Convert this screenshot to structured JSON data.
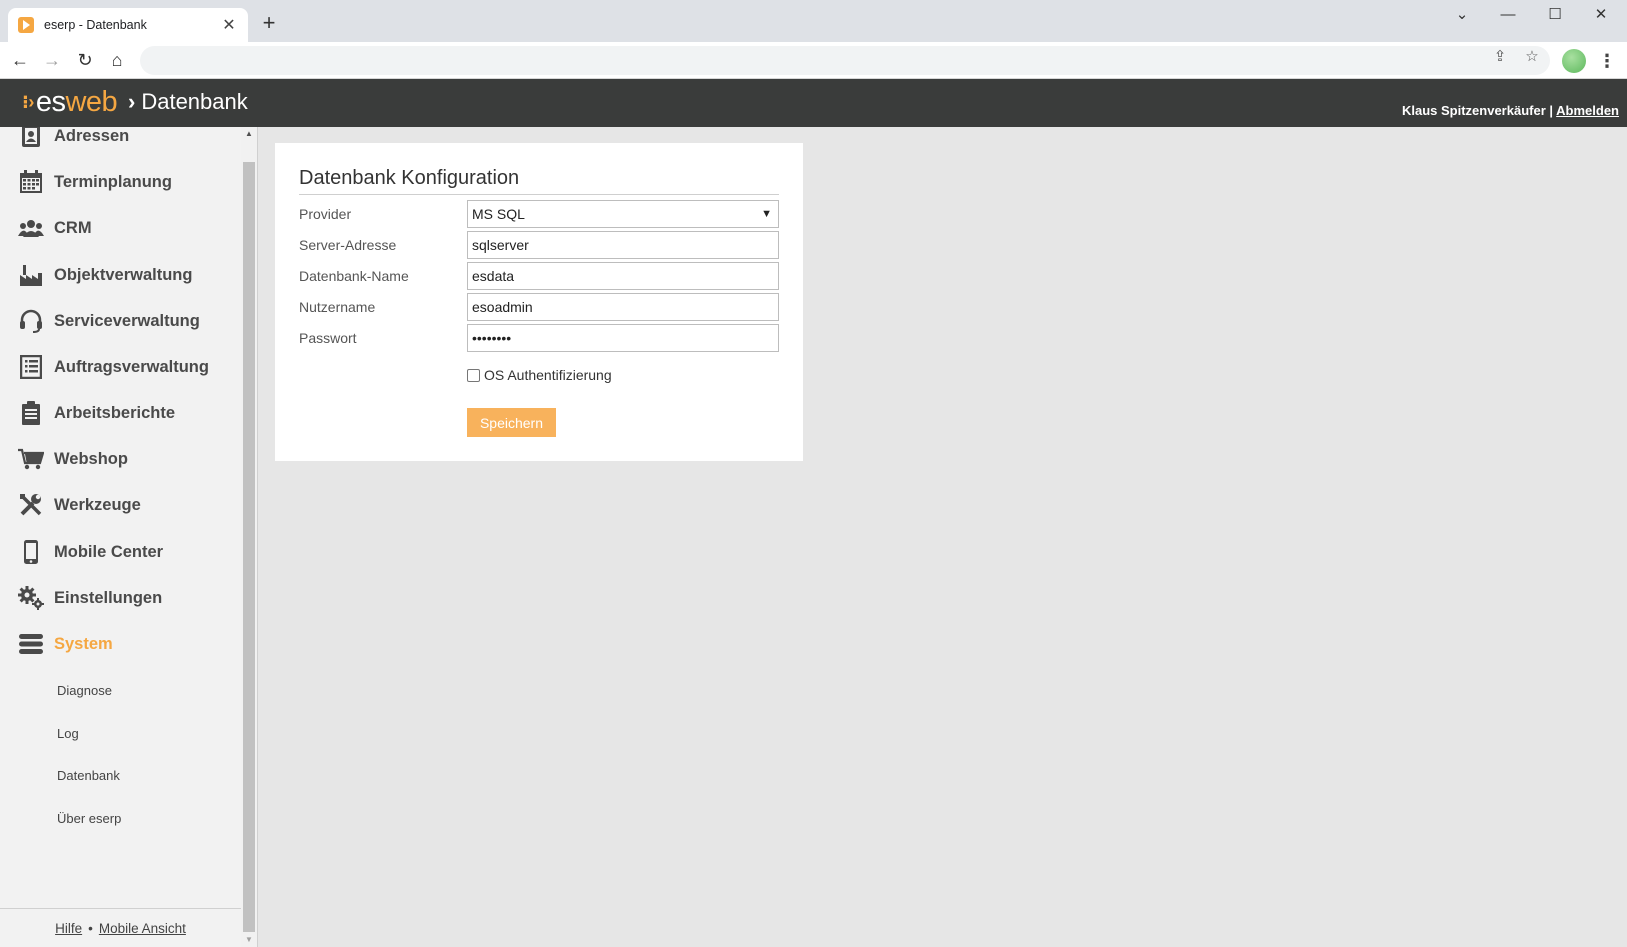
{
  "browser": {
    "tab_title": "eserp - Datenbank",
    "tab_close": "✕",
    "new_tab": "+",
    "nav": {
      "back": "←",
      "forward": "→",
      "reload": "↻",
      "home": "⌂"
    },
    "window_controls": {
      "minimize": "—",
      "maximize": "☐",
      "close": "✕",
      "tab_search": "⌄"
    },
    "url": "",
    "menu": "⋮"
  },
  "header": {
    "logo_es": "es",
    "logo_web": "web",
    "breadcrumb_sep": "›",
    "breadcrumb": "Datenbank",
    "user": "Klaus Spitzenverkäufer |",
    "logout": "Abmelden"
  },
  "sidebar": {
    "items": [
      {
        "label": "Adressen",
        "icon": "address-book-icon"
      },
      {
        "label": "Terminplanung",
        "icon": "calendar-icon"
      },
      {
        "label": "CRM",
        "icon": "users-icon"
      },
      {
        "label": "Objektverwaltung",
        "icon": "factory-icon"
      },
      {
        "label": "Serviceverwaltung",
        "icon": "headset-icon"
      },
      {
        "label": "Auftragsverwaltung",
        "icon": "list-icon"
      },
      {
        "label": "Arbeitsberichte",
        "icon": "clipboard-icon"
      },
      {
        "label": "Webshop",
        "icon": "cart-icon"
      },
      {
        "label": "Werkzeuge",
        "icon": "tools-icon"
      },
      {
        "label": "Mobile Center",
        "icon": "mobile-icon"
      },
      {
        "label": "Einstellungen",
        "icon": "gears-icon"
      },
      {
        "label": "System",
        "icon": "database-icon",
        "active": true
      }
    ],
    "subitems": [
      "Diagnose",
      "Log",
      "Datenbank",
      "Über eserp"
    ],
    "footer": {
      "help": "Hilfe",
      "dot": "•",
      "mobile": "Mobile Ansicht"
    }
  },
  "form": {
    "title": "Datenbank Konfiguration",
    "provider": {
      "label": "Provider",
      "value": "MS SQL"
    },
    "server": {
      "label": "Server-Adresse",
      "value": "sqlserver"
    },
    "dbname": {
      "label": "Datenbank-Name",
      "value": "esdata"
    },
    "username": {
      "label": "Nutzername",
      "value": "esoadmin"
    },
    "password": {
      "label": "Passwort",
      "value": "••••••••"
    },
    "os_auth": {
      "label": "OS Authentifizierung",
      "checked": false
    },
    "save": "Speichern"
  },
  "colors": {
    "accent": "#f5a742",
    "appbar": "#3a3c3b",
    "button": "#f8b25c"
  }
}
